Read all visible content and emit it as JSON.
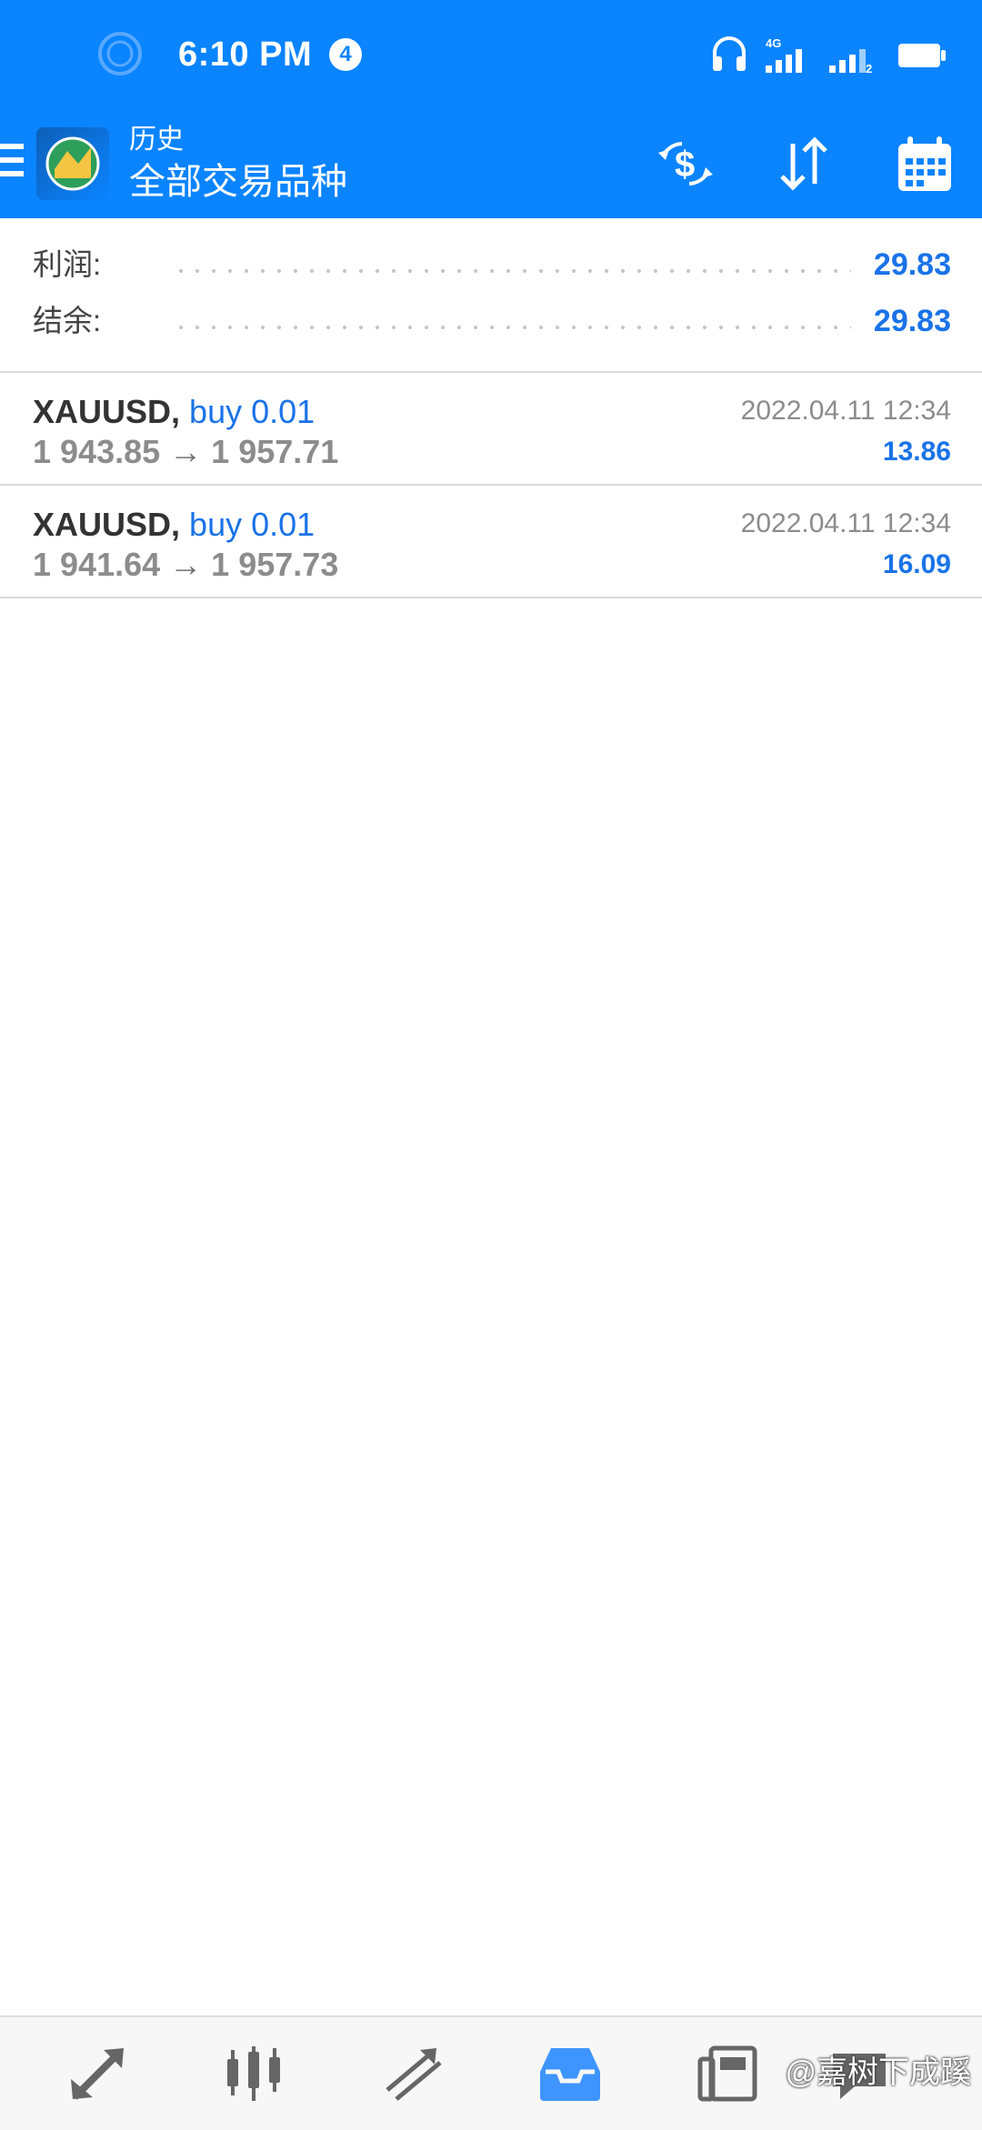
{
  "status_bar": {
    "time": "6:10 PM",
    "notification_count": "4",
    "icons": [
      "ring-icon",
      "headset-icon",
      "signal-4g-icon",
      "signal-2-icon",
      "battery-icon"
    ],
    "network_label": "4G",
    "sim2_label": "2"
  },
  "app_bar": {
    "subtitle": "历史",
    "title": "全部交易品种",
    "icons": [
      "menu-icon",
      "metatrader-logo",
      "currency-exchange-icon",
      "sort-icon",
      "calendar-icon"
    ],
    "accent_color": "#0a84ff"
  },
  "summary": {
    "profit_label": "利润:",
    "profit_value": "29.83",
    "balance_label": "结余:",
    "balance_value": "29.83"
  },
  "deals": [
    {
      "symbol": "XAUUSD",
      "separator": ",",
      "direction": "buy 0.01",
      "open_price": "1 943.85",
      "arrow": "→",
      "close_price": "1 957.71",
      "time": "2022.04.11 12:34",
      "profit": "13.86"
    },
    {
      "symbol": "XAUUSD",
      "separator": ",",
      "direction": "buy 0.01",
      "open_price": "1 941.64",
      "arrow": "→",
      "close_price": "1 957.73",
      "time": "2022.04.11 12:34",
      "profit": "16.09"
    }
  ],
  "bottom_nav": {
    "items": [
      "quotes-icon",
      "chart-icon",
      "trade-icon",
      "history-icon",
      "news-icon",
      "chat-icon"
    ],
    "active": "history-icon",
    "watermark": "@嘉树下成蹊"
  }
}
